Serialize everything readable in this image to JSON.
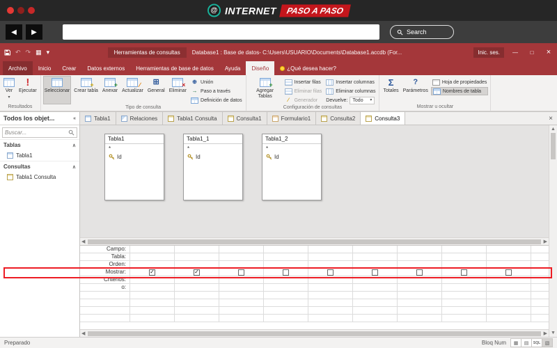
{
  "chrome": {
    "logo": {
      "internet": "INTERNET",
      "paso1": "PASO",
      "a": "A",
      "paso2": "PASO",
      "at": "@"
    },
    "search_label": "Search"
  },
  "icons": {
    "back": "◀",
    "forward": "▶",
    "close": "×",
    "minimize": "—",
    "maximize": "□",
    "dropdown": "▾",
    "chevron_up": "∧",
    "collapse": "«",
    "check": "✓",
    "scroll_up": "▲",
    "scroll_down": "▼",
    "scroll_left": "◀",
    "scroll_right": "▶",
    "run": "!",
    "union": "⊕",
    "passthrough": "→",
    "totals": "Σ",
    "parameters": "?",
    "builder": "∕",
    "pencil": "∕",
    "plus_gold": "+",
    "plus_green": "+",
    "cross_red": "×",
    "crosstab": "⊞",
    "undo": "↶",
    "redo": "↷",
    "grid": "▦",
    "sheet": "▤",
    "design_view": "▧"
  },
  "titlebar": {
    "context_tab": "Herramientas de consultas",
    "title": "Database1 : Base de datos- C:\\Users\\USUARIO\\Documents\\Database1.accdb (For...",
    "sign_in": "Inic. ses."
  },
  "ribbon_tabs": [
    {
      "label": "Archivo",
      "file": true
    },
    {
      "label": "Inicio"
    },
    {
      "label": "Crear"
    },
    {
      "label": "Datos externos"
    },
    {
      "label": "Herramientas de base de datos"
    },
    {
      "label": "Ayuda"
    },
    {
      "label": "Diseño",
      "active": true
    },
    {
      "label": "¿Qué desea hacer?",
      "help": true
    }
  ],
  "ribbon": {
    "groups": [
      {
        "label": "Resultados",
        "big": [
          {
            "label": "Ver",
            "icon": "datasheet-icon",
            "dropdown": true
          },
          {
            "label": "Ejecutar",
            "icon": "run-icon",
            "glyph": "run"
          }
        ]
      },
      {
        "label": "Tipo de consulta",
        "big": [
          {
            "label": "Seleccionar",
            "icon": "select-query-icon",
            "pressed": true
          },
          {
            "label": "Crear tabla",
            "icon": "make-table-icon",
            "badge": "plus_gold"
          },
          {
            "label": "Anexar",
            "icon": "append-query-icon",
            "badge": "plus_green"
          },
          {
            "label": "Actualizar",
            "icon": "update-query-icon",
            "badge": "pencil"
          },
          {
            "label": "General",
            "icon": "crosstab-icon",
            "glyph": "crosstab"
          },
          {
            "label": "Eliminar",
            "icon": "delete-query-icon",
            "badge": "cross_red"
          }
        ],
        "smallcols": [
          [
            {
              "label": "Unión",
              "icon": "union-icon",
              "glyph": "union"
            },
            {
              "label": "Paso a través",
              "icon": "passthrough-icon",
              "glyph": "passthrough"
            },
            {
              "label": "Definición de datos",
              "icon": "data-definition-icon"
            }
          ]
        ]
      },
      {
        "label": "Configuración de consultas",
        "big": [
          {
            "label": "Agregar Tablas",
            "icon": "add-tables-icon",
            "badge": "plus_green"
          }
        ],
        "smallcols": [
          [
            {
              "label": "Insertar filas",
              "icon": "insert-rows-icon"
            },
            {
              "label": "Eliminar filas",
              "icon": "delete-rows-icon",
              "disabled": true
            },
            {
              "label": "Generador",
              "icon": "builder-icon",
              "glyph": "builder",
              "disabled": true
            }
          ],
          [
            {
              "label": "Insertar columnas",
              "icon": "insert-columns-icon"
            },
            {
              "label": "Eliminar columnas",
              "icon": "delete-columns-icon"
            },
            {
              "label": "Devuelve:",
              "combo": "Todo"
            }
          ]
        ]
      },
      {
        "label": "Mostrar u ocultar",
        "big": [
          {
            "label": "Totales",
            "icon": "totals-icon",
            "glyph": "totals"
          },
          {
            "label": "Parámetros",
            "icon": "parameters-icon",
            "glyph": "parameters"
          }
        ],
        "smallcols": [
          [
            {
              "label": "Hoja de propiedades",
              "icon": "property-sheet-icon"
            },
            {
              "label": "Nombres de tabla",
              "icon": "table-names-icon",
              "pressed": true
            }
          ]
        ]
      }
    ]
  },
  "nav_pane": {
    "title": "Todos los objet...",
    "search_placeholder": "Buscar...",
    "sections": [
      {
        "name": "Tablas",
        "items": [
          {
            "label": "Tabla1",
            "icon": "table-obj-icon"
          }
        ]
      },
      {
        "name": "Consultas",
        "items": [
          {
            "label": "Tabla1 Consulta",
            "icon": "query-obj-icon"
          }
        ]
      }
    ]
  },
  "doc_tabs": [
    {
      "label": "Tabla1",
      "icon": "table-obj-icon"
    },
    {
      "label": "Relaciones",
      "icon": "relationship-icon"
    },
    {
      "label": "Tabla1 Consulta",
      "icon": "query-obj-icon"
    },
    {
      "label": "Consulta1",
      "icon": "query-obj-icon"
    },
    {
      "label": "Formulario1",
      "icon": "form-obj-icon"
    },
    {
      "label": "Consulta2",
      "icon": "query-obj-icon"
    },
    {
      "label": "Consulta3",
      "icon": "query-obj-icon",
      "active": true
    }
  ],
  "design": {
    "tables": [
      {
        "name": "Tabla1",
        "fields": [
          {
            "label": "*"
          },
          {
            "label": "Id",
            "key": true
          }
        ]
      },
      {
        "name": "Tabla1_1",
        "fields": [
          {
            "label": "*"
          },
          {
            "label": "Id",
            "key": true
          }
        ]
      },
      {
        "name": "Tabla1_2",
        "fields": [
          {
            "label": "*"
          },
          {
            "label": "Id",
            "key": true
          }
        ]
      }
    ]
  },
  "grid": {
    "rows": [
      "Campo:",
      "Tabla:",
      "Orden:",
      "Mostrar:",
      "Criterios:",
      "o:",
      "",
      "",
      "",
      ""
    ],
    "columns": 10,
    "mostrar_checks": [
      true,
      true,
      false,
      false,
      false,
      false,
      false,
      false,
      false,
      false
    ]
  },
  "status": {
    "left": "Preparado",
    "numlock": "Bloq Num",
    "sql": "SQL"
  }
}
